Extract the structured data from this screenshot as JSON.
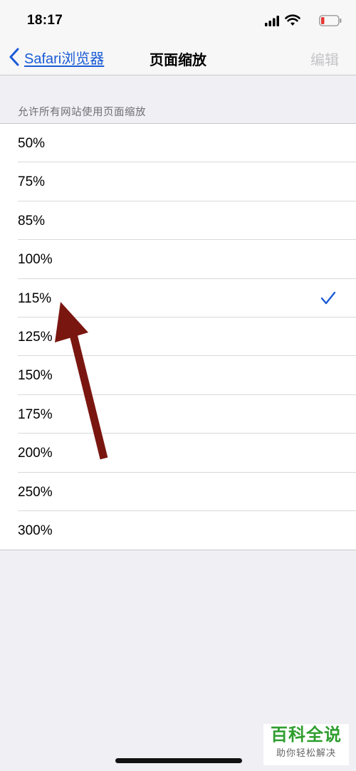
{
  "status_bar": {
    "time": "18:17",
    "icons": [
      "signal-icon",
      "wifi-icon",
      "battery-icon"
    ],
    "battery_color": "#e53935"
  },
  "nav": {
    "back_label": "Safari浏览器",
    "title": "页面缩放",
    "edit_label": "编辑",
    "accent": "#1a5bd6"
  },
  "section": {
    "header": "允许所有网站使用页面缩放"
  },
  "zoom_options": [
    {
      "label": "50%",
      "selected": false
    },
    {
      "label": "75%",
      "selected": false
    },
    {
      "label": "85%",
      "selected": false
    },
    {
      "label": "100%",
      "selected": false
    },
    {
      "label": "115%",
      "selected": true
    },
    {
      "label": "125%",
      "selected": false
    },
    {
      "label": "150%",
      "selected": false
    },
    {
      "label": "175%",
      "selected": false
    },
    {
      "label": "200%",
      "selected": false
    },
    {
      "label": "250%",
      "selected": false
    },
    {
      "label": "300%",
      "selected": false
    }
  ],
  "annotation": {
    "arrow_color": "#7a1610"
  },
  "watermark": {
    "title": "百科全说",
    "subtitle": "助你轻松解决"
  }
}
